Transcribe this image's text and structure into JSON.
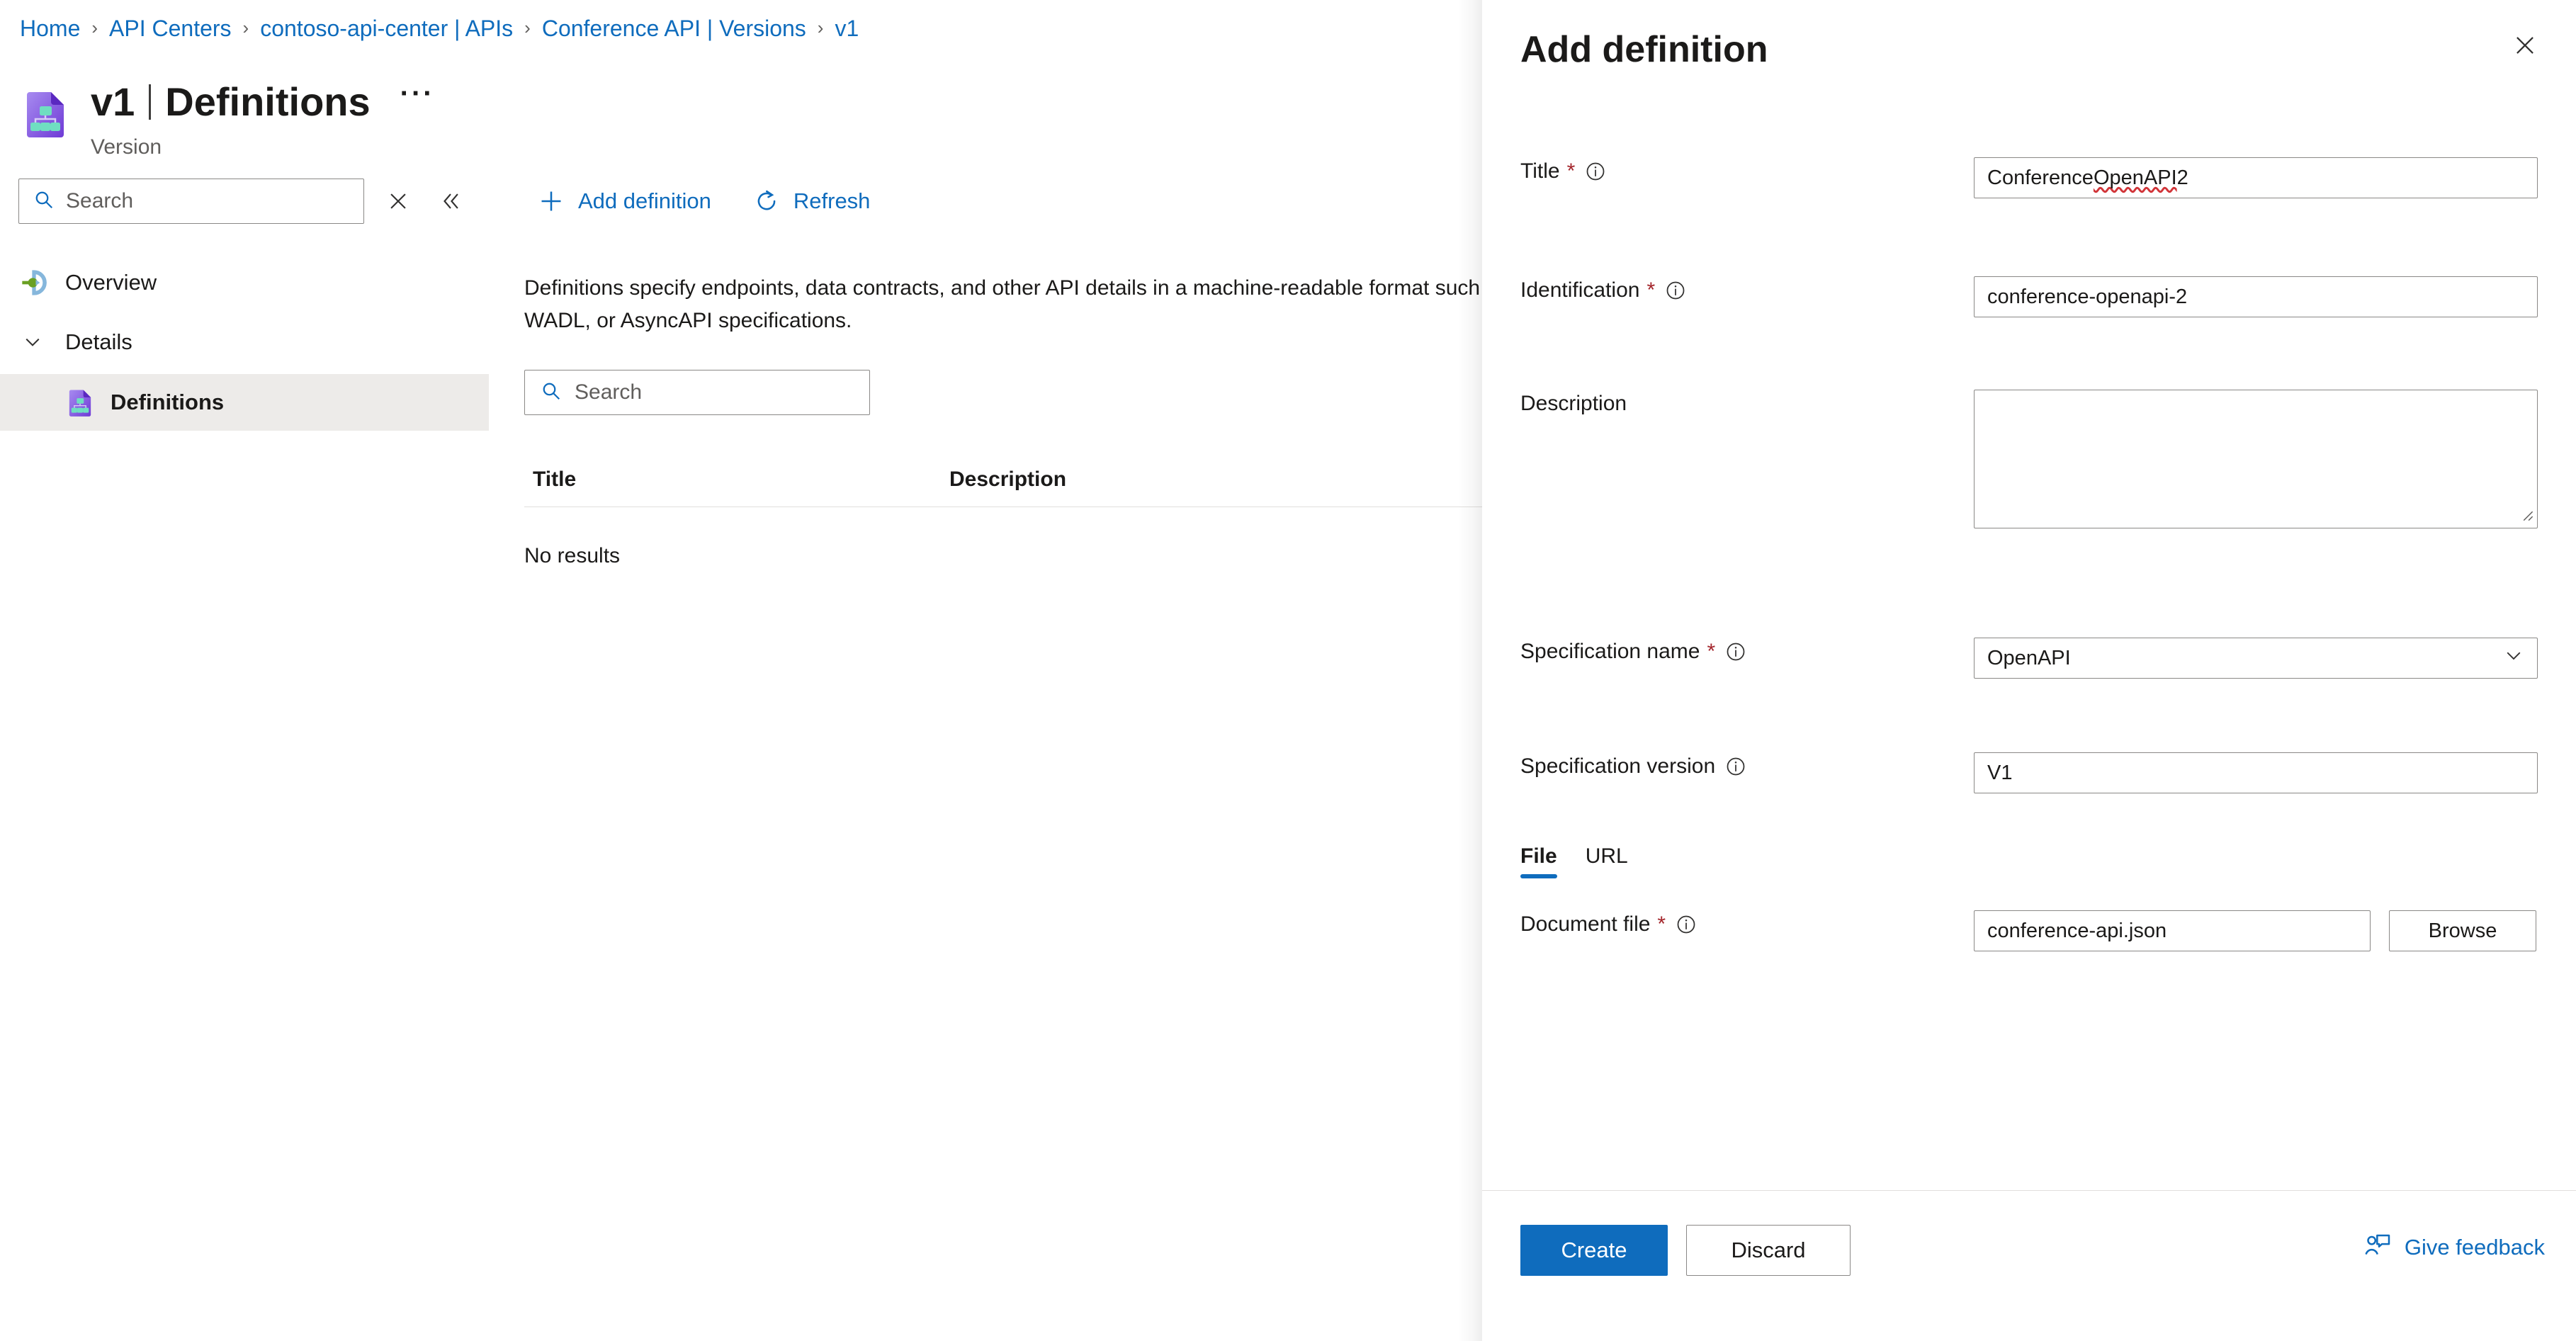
{
  "breadcrumb": {
    "separator": "›",
    "items": [
      {
        "label": "Home"
      },
      {
        "label": "API Centers"
      },
      {
        "label": "contoso-api-center | APIs"
      },
      {
        "label": "Conference API | Versions"
      },
      {
        "label": "v1"
      }
    ]
  },
  "page": {
    "title_main": "v1",
    "title_sep": "|",
    "title_sub": "Definitions",
    "ellipsis": "···",
    "subtitle": "Version",
    "icon": "api-definition-icon"
  },
  "leftnav": {
    "search": {
      "placeholder": "Search",
      "value": "",
      "icon": "search-icon"
    },
    "close_icon": "close-icon",
    "collapse_icon": "double-chevron-left-icon",
    "items": [
      {
        "label": "Overview",
        "icon": "overview-icon"
      }
    ],
    "group": {
      "label": "Details",
      "icon": "chevron-down-icon"
    },
    "children": [
      {
        "label": "Definitions",
        "icon": "api-definition-icon",
        "selected": true
      }
    ]
  },
  "toolbar": {
    "add_definition_label": "Add definition",
    "add_definition_icon": "plus-icon",
    "refresh_label": "Refresh",
    "refresh_icon": "refresh-icon"
  },
  "main": {
    "description": "Definitions specify endpoints, data contracts, and other API details in a machine-readable format such as OpenAPI, gRPC, GraphQL, WSDL, WADL, or AsyncAPI specifications.",
    "search": {
      "placeholder": "Search",
      "value": "",
      "icon": "search-icon"
    },
    "table": {
      "columns": [
        "Title",
        "Description"
      ],
      "rows": [],
      "empty_text": "No results"
    }
  },
  "panel": {
    "title": "Add definition",
    "close_icon": "close-icon",
    "fields": {
      "title": {
        "label": "Title",
        "required": "*",
        "info_icon": "info-icon",
        "value": "Conference OpenAPI 2",
        "value_spellchecked_part": "OpenAPI",
        "value_prefix": "Conference ",
        "value_suffix": " 2"
      },
      "identification": {
        "label": "Identification",
        "required": "*",
        "info_icon": "info-icon",
        "value": "conference-openapi-2"
      },
      "description": {
        "label": "Description",
        "value": "",
        "placeholder": ""
      },
      "specification_name": {
        "label": "Specification name",
        "required": "*",
        "info_icon": "info-icon",
        "value": "OpenAPI",
        "chevron_icon": "chevron-down-icon",
        "options": [
          "OpenAPI"
        ]
      },
      "specification_version": {
        "label": "Specification version",
        "info_icon": "info-icon",
        "value": "V1"
      },
      "document_file": {
        "label": "Document file",
        "required": "*",
        "info_icon": "info-icon",
        "value": "conference-api.json",
        "browse_label": "Browse"
      }
    },
    "tabs": [
      {
        "label": "File",
        "active": true
      },
      {
        "label": "URL",
        "active": false
      }
    ],
    "footer": {
      "create_label": "Create",
      "discard_label": "Discard",
      "feedback_label": "Give feedback",
      "feedback_icon": "person-feedback-icon"
    }
  },
  "colors": {
    "accent": "#0f6cbd",
    "link": "#0f6cbd",
    "required": "#a4262c",
    "selected_bg": "#edebe9",
    "border": "#8a8886",
    "text": "#1b1a19",
    "muted": "#605e5c",
    "spell_error": "#d13438"
  }
}
